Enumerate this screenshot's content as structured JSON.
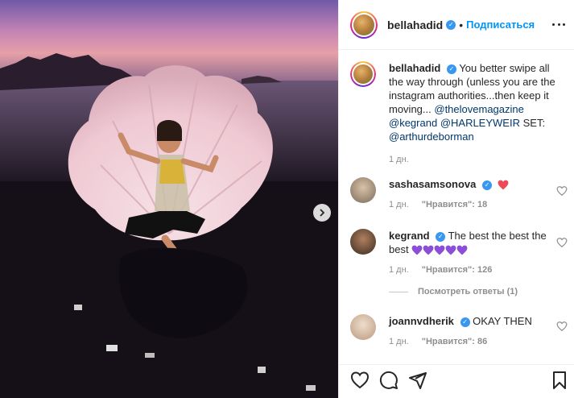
{
  "post": {
    "username": "bellahadid",
    "follow_label": "Подписаться",
    "dot": "•"
  },
  "caption": {
    "username": "bellahadid",
    "text": "You better swipe all the way through (unless you are the instagram authorities...then keep it moving...",
    "mentions": [
      "@thelovemagazine",
      "@kegrand",
      "@HARLEYWEIR"
    ],
    "set_label": "SET:",
    "set_mention": "@arthurdeborman",
    "time": "1 дн."
  },
  "comments": [
    {
      "username": "sashasamsonova",
      "text": "",
      "emoji": "heart",
      "time": "1 дн.",
      "likes": "\"Нравится\": 18",
      "reply": ""
    },
    {
      "username": "kegrand",
      "text": "The best the best the best",
      "emoji": "purple-hearts",
      "time": "1 дн.",
      "likes": "\"Нравится\": 126",
      "reply": ""
    },
    {
      "username": "joannvdherik",
      "text": "OKAY THEN",
      "emoji": "",
      "time": "1 дн.",
      "likes": "\"Нравится\": 86",
      "reply": ""
    }
  ],
  "view_replies": "Посмотреть ответы (1)",
  "colors": {
    "accent": "#0095f6",
    "verified": "#3897f0",
    "heart": "#ed4956",
    "purple_heart": "#8a4fd6"
  },
  "icons": [
    "heart-icon",
    "comment-icon",
    "share-icon",
    "bookmark-icon",
    "more-options-icon",
    "chevron-right-icon",
    "verified-icon"
  ]
}
